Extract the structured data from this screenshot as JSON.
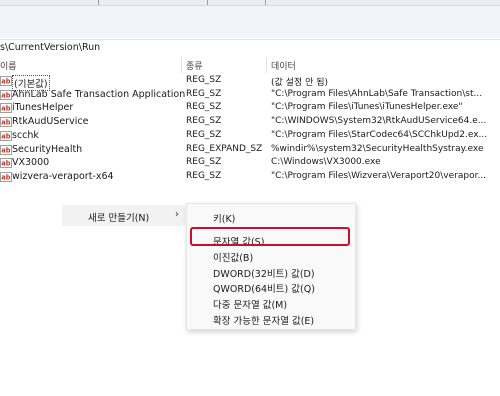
{
  "address": "s\\CurrentVersion\\Run",
  "columns": {
    "name": "이름",
    "type": "종류",
    "data": "데이터"
  },
  "rows": [
    {
      "name": "(기본값)",
      "type": "REG_SZ",
      "data": "(값 설정 안 됨)"
    },
    {
      "name": "AhnLab Safe Transaction Application",
      "type": "REG_SZ",
      "data": "\"C:\\Program Files\\AhnLab\\Safe Transaction\\st..."
    },
    {
      "name": "iTunesHelper",
      "type": "REG_SZ",
      "data": "\"C:\\Program Files\\iTunes\\iTunesHelper.exe\""
    },
    {
      "name": "RtkAudUService",
      "type": "REG_SZ",
      "data": "\"C:\\WINDOWS\\System32\\RtkAudUService64.e..."
    },
    {
      "name": "scchk",
      "type": "REG_SZ",
      "data": "\"C:\\Program Files\\StarCodec64\\SCChkUpd2.ex..."
    },
    {
      "name": "SecurityHealth",
      "type": "REG_EXPAND_SZ",
      "data": "%windir%\\system32\\SecurityHealthSystray.exe"
    },
    {
      "name": "VX3000",
      "type": "REG_SZ",
      "data": "C:\\Windows\\VX3000.exe"
    },
    {
      "name": "wizvera-veraport-x64",
      "type": "REG_SZ",
      "data": "\"C:\\Program Files\\Wizvera\\Veraport20\\verapor..."
    }
  ],
  "context_menu": {
    "new_label": "새로 만들기(N)",
    "arrow": "›",
    "items": [
      {
        "label": "키(K)"
      },
      {
        "label": "문자열 값(S)"
      },
      {
        "label": "이진값(B)"
      },
      {
        "label": "DWORD(32비트) 값(D)"
      },
      {
        "label": "QWORD(64비트) 값(Q)"
      },
      {
        "label": "다중 문자열 값(M)"
      },
      {
        "label": "확장 가능한 문자열 값(E)"
      }
    ]
  },
  "colors": {
    "highlight": "#c8102e",
    "icon": "#c0392b"
  }
}
